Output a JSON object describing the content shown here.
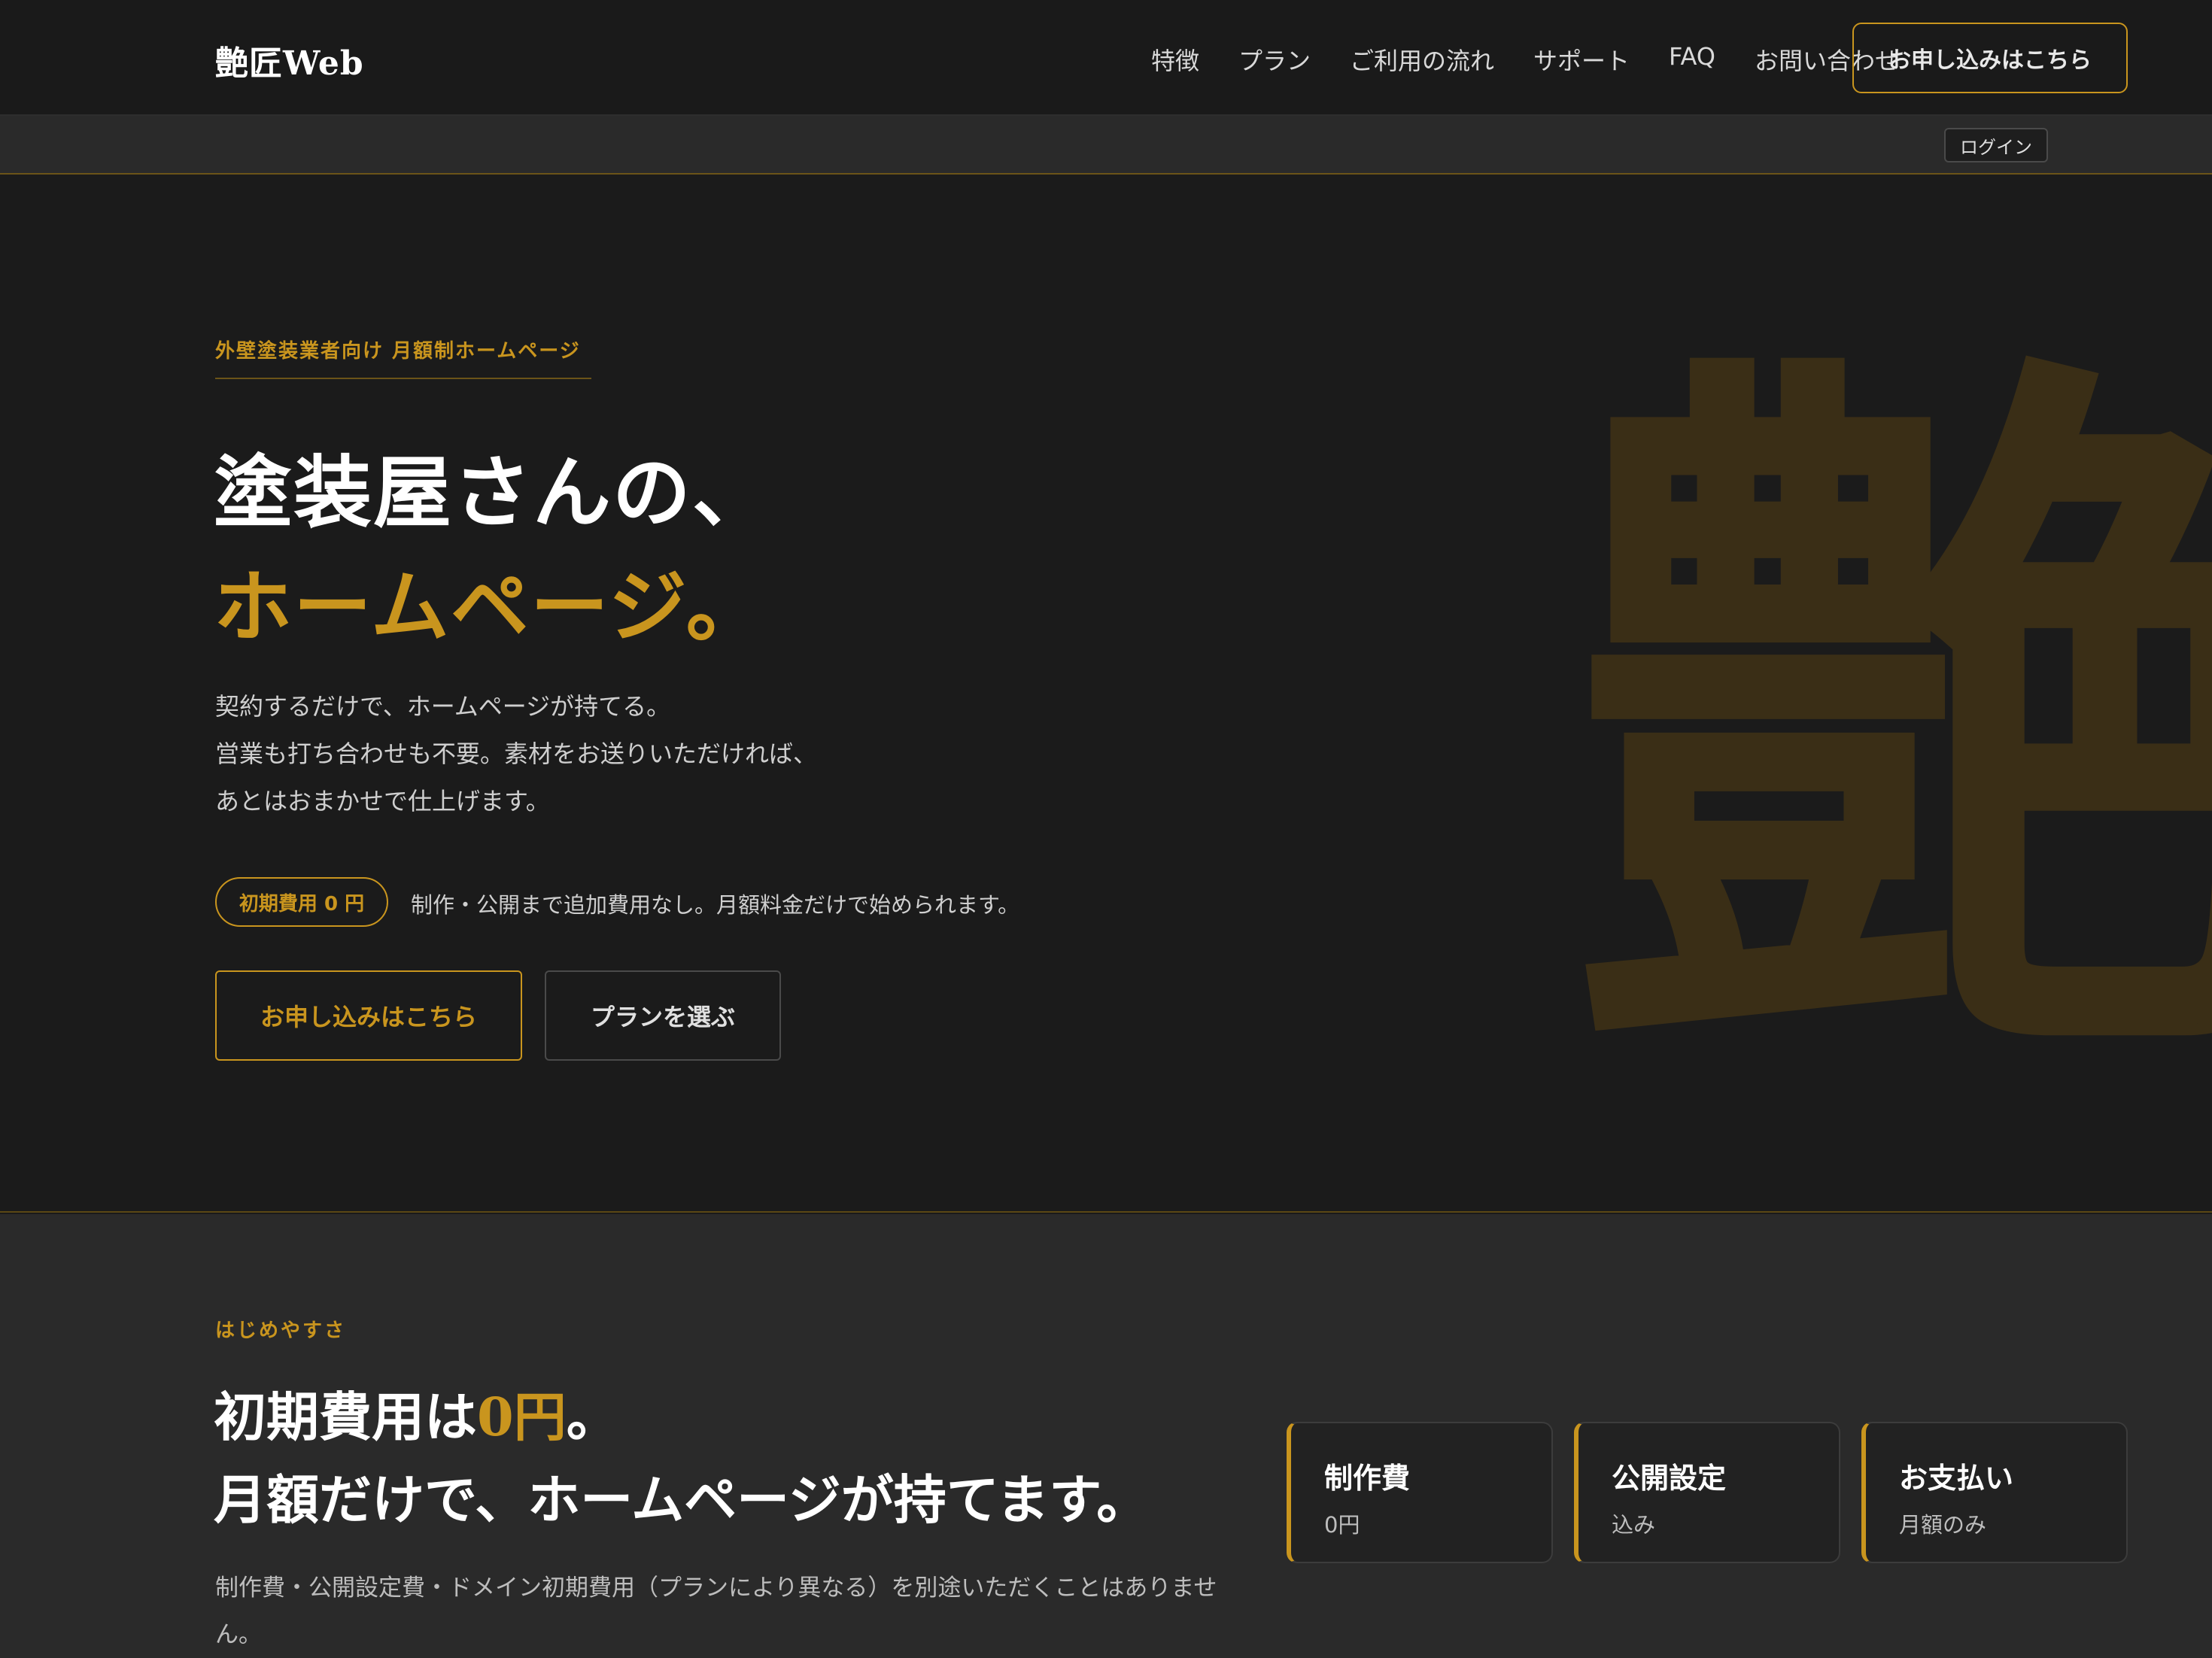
{
  "header": {
    "logo": "艶匠Web",
    "nav": [
      "特徴",
      "プラン",
      "ご利用の流れ",
      "サポート",
      "FAQ",
      "お問い合わせ"
    ],
    "cta_label": "お申し込みはこちら",
    "login_label": "ログイン"
  },
  "hero": {
    "eyebrow": "外壁塗装業者向け 月額制ホームページ",
    "title_line1": "塗装屋さんの、",
    "title_line2": "ホームページ。",
    "body": [
      "契約するだけで、ホームページが持てる。",
      "営業も打ち合わせも不要。素材をお送りいただければ、",
      "あとはおまかせで仕上げます。"
    ],
    "pill": "初期費用 0 円",
    "pill_note": "制作・公開まで追加費用なし。月額料金だけで始められます。",
    "primary_button": "お申し込みはこちら",
    "secondary_button": "プランを選ぶ",
    "watermark": "艶"
  },
  "feature": {
    "eyebrow": "はじめやすさ",
    "title_prefix": "初期費用は",
    "title_accent": "0円",
    "title_suffix": "。",
    "title_line2": "月額だけで、ホームページが持てます。",
    "body": "制作費・公開設定費・ドメイン初期費用（プランにより異なる）を別途いただくことはありません。",
    "cards": [
      {
        "title": "制作費",
        "value": "0円"
      },
      {
        "title": "公開設定",
        "value": "込み"
      },
      {
        "title": "お支払い",
        "value": "月額のみ"
      }
    ]
  },
  "colors": {
    "accent": "#c9951e",
    "background": "#1a1a1a",
    "section_background": "#2a2a2a"
  }
}
